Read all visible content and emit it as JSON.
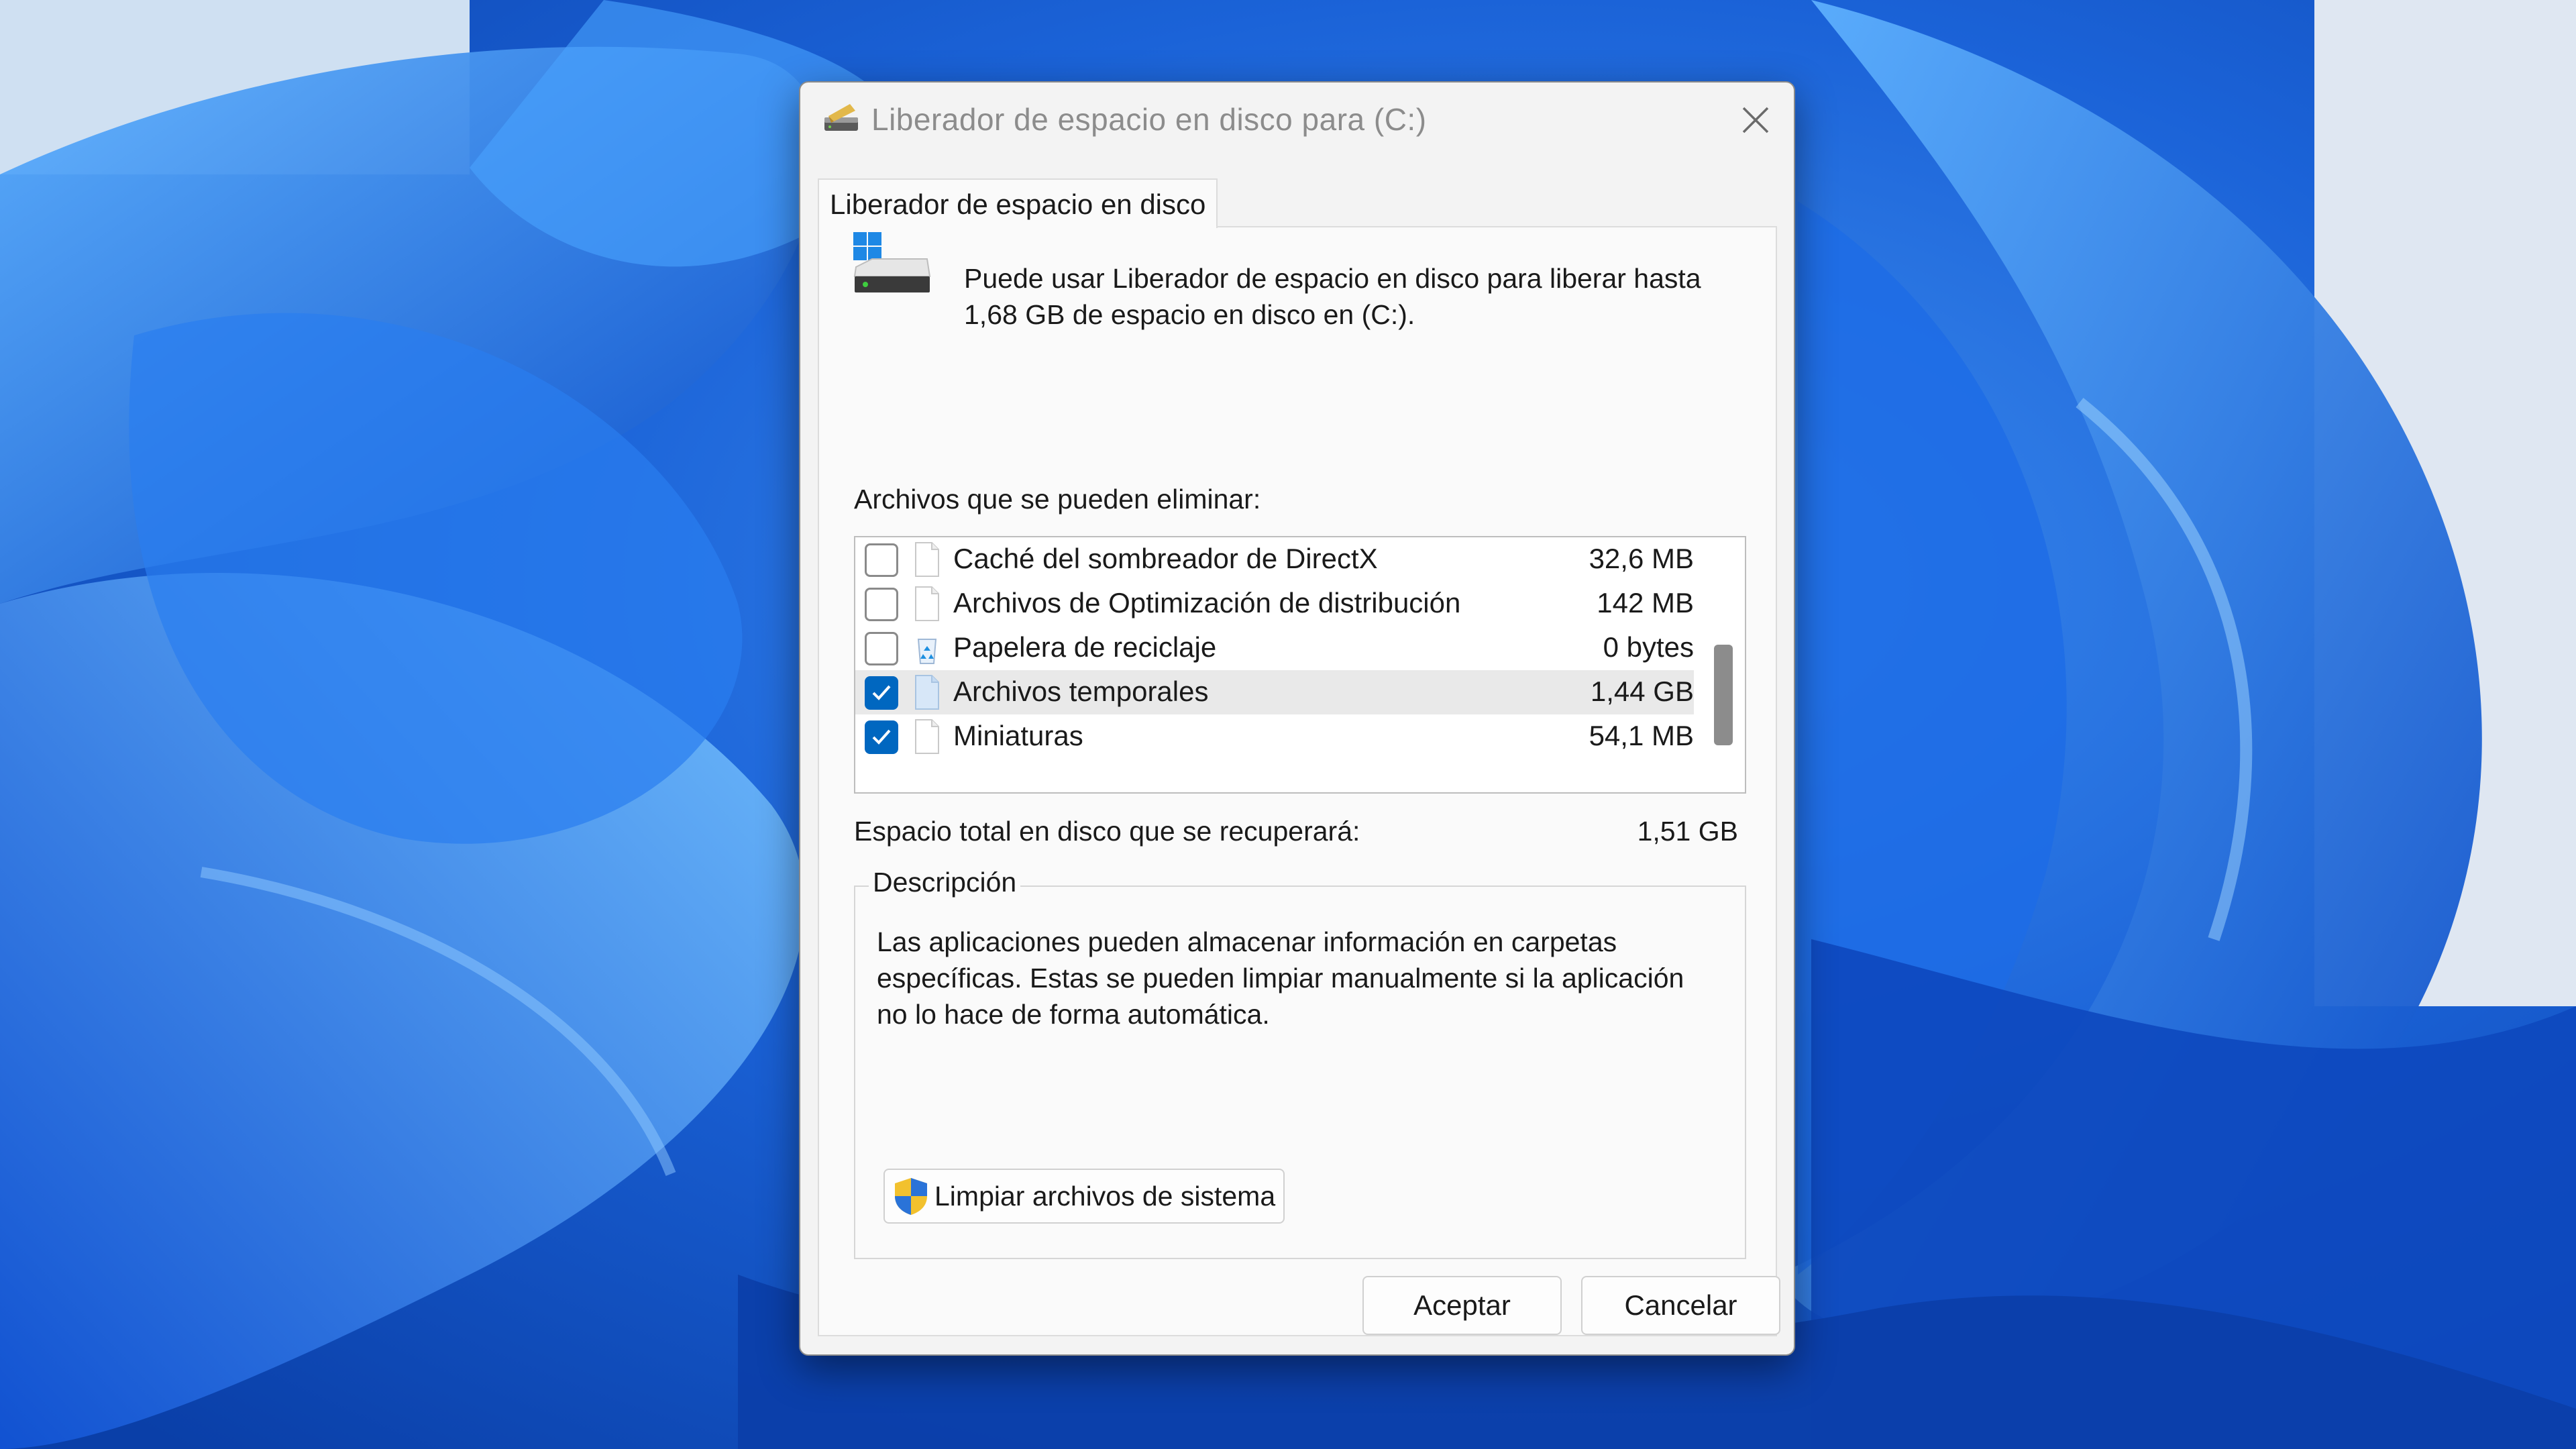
{
  "window": {
    "title": "Liberador de espacio en disco para  (C:)",
    "icon": "disk-cleanup-icon"
  },
  "tab": {
    "label": "Liberador de espacio en disco"
  },
  "intro": {
    "line1": "Puede usar Liberador de espacio en disco para liberar hasta",
    "line2": "1,68 GB de espacio en disco en  (C:)."
  },
  "files_label": "Archivos que se pueden eliminar:",
  "files": [
    {
      "name": "Caché del sombreador de DirectX",
      "size": "32,6 MB",
      "checked": false,
      "icon": "file-icon"
    },
    {
      "name": "Archivos de Optimización de distribución",
      "size": "142 MB",
      "checked": false,
      "icon": "file-icon"
    },
    {
      "name": "Papelera de reciclaje",
      "size": "0 bytes",
      "checked": false,
      "icon": "recycle-bin-icon"
    },
    {
      "name": "Archivos temporales",
      "size": "1,44 GB",
      "checked": true,
      "selected": true,
      "icon": "file-icon"
    },
    {
      "name": "Miniaturas",
      "size": "54,1 MB",
      "checked": true,
      "icon": "file-icon"
    }
  ],
  "total": {
    "label": "Espacio total en disco que se recuperará:",
    "value": "1,51 GB"
  },
  "description": {
    "legend": "Descripción",
    "line1": "Las aplicaciones pueden almacenar información en carpetas",
    "line2": "específicas. Estas se pueden limpiar manualmente si la aplicación",
    "line3": "no lo hace de forma automática."
  },
  "system_button": {
    "label": "Limpiar archivos de sistema",
    "icon": "uac-shield-icon"
  },
  "buttons": {
    "ok": "Aceptar",
    "cancel": "Cancelar"
  },
  "colors": {
    "accent": "#0067c0",
    "wallpaper": "#0a5fd8"
  }
}
